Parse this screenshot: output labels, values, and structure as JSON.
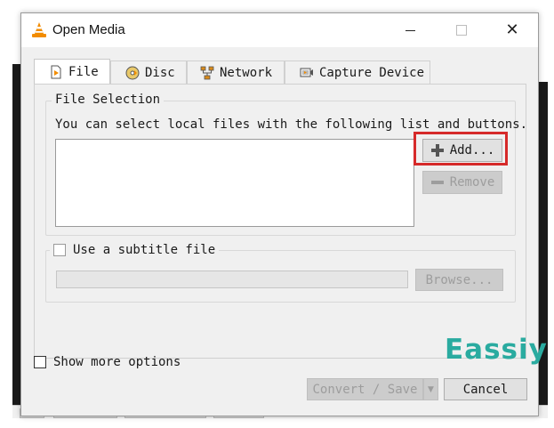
{
  "window": {
    "title": "Open Media",
    "icon": "vlc-cone-icon",
    "controls": [
      "minimize-icon",
      "maximize-icon",
      "close-icon"
    ]
  },
  "tabs": [
    {
      "label": "File",
      "icon": "file-icon",
      "active": true
    },
    {
      "label": "Disc",
      "icon": "disc-icon",
      "active": false
    },
    {
      "label": "Network",
      "icon": "network-icon",
      "active": false
    },
    {
      "label": "Capture Device",
      "icon": "capture-device-icon",
      "active": false
    }
  ],
  "file_selection": {
    "legend": "File Selection",
    "description": "You can select local files with the following list and buttons.",
    "add_label": "Add...",
    "remove_label": "Remove",
    "add_icon": "plus-icon",
    "remove_icon": "minus-icon"
  },
  "subtitle": {
    "checkbox_label": "Use a subtitle file",
    "checked": false,
    "browse_label": "Browse..."
  },
  "footer": {
    "show_more_label": "Show more options",
    "show_more_checked": false,
    "convert_label": "Convert / Save",
    "cancel_label": "Cancel"
  },
  "watermark": "Eassiy",
  "colors": {
    "highlight": "#d62a2a",
    "watermark": "#2aaba0",
    "vlc_orange": "#f28c00"
  }
}
